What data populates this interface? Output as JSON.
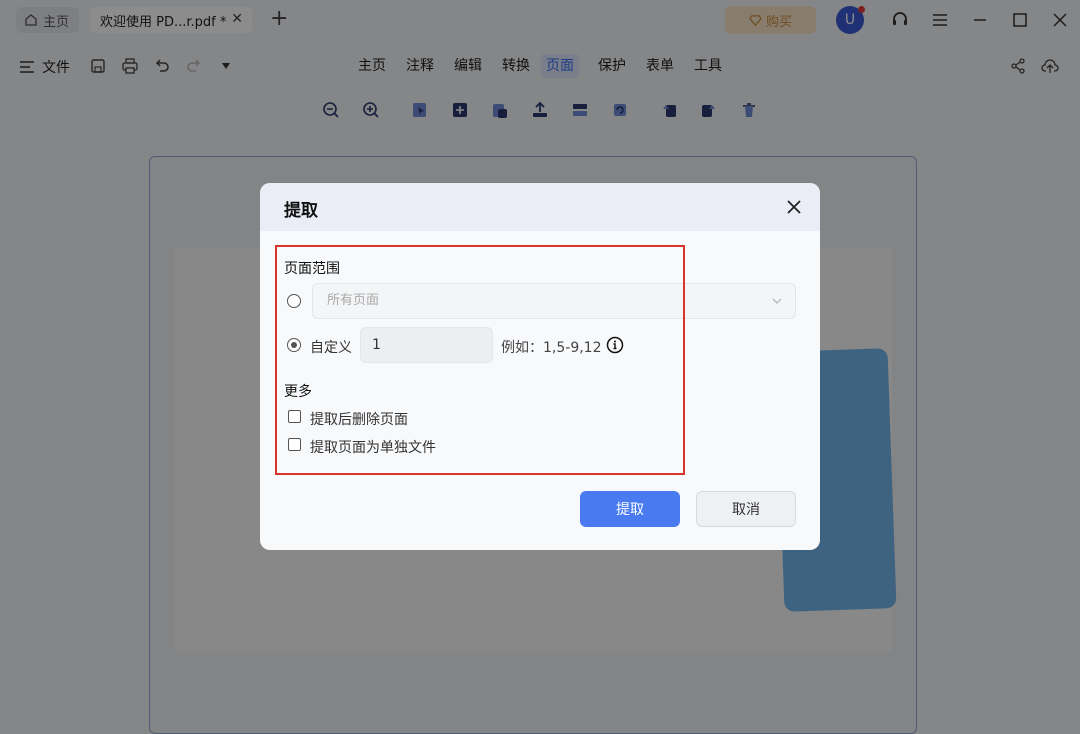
{
  "titlebar": {
    "home_tab": "主页",
    "doc_tab": "欢迎使用 PD...r.pdf *",
    "buy_label": "购买",
    "avatar_letter": "U"
  },
  "menubar": {
    "file_label": "文件",
    "tabs": [
      "主页",
      "注释",
      "编辑",
      "转换",
      "页面",
      "保护",
      "表单",
      "工具"
    ],
    "active_tab": "页面"
  },
  "dialog": {
    "title": "提取",
    "page_range_title": "页面范围",
    "all_pages_placeholder": "所有页面",
    "custom_label": "自定义",
    "custom_value": "1",
    "example_hint": "例如：1,5-9,12",
    "more_title": "更多",
    "delete_after_extract": "提取后删除页面",
    "extract_as_separate": "提取页面为单独文件",
    "confirm_button": "提取",
    "cancel_button": "取消",
    "selected_option": "custom"
  },
  "colors": {
    "accent": "#4a7af0",
    "highlight_box": "#d9342b",
    "buy_bg": "#f8e3c6",
    "avatar": "#3b58d6"
  }
}
